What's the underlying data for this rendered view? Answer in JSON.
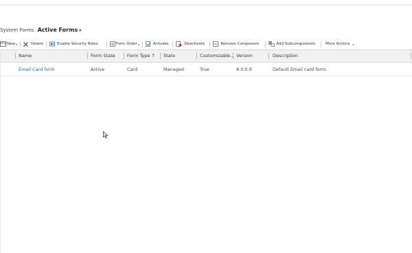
{
  "view": {
    "prefix": "System Forms",
    "name": "Active Forms"
  },
  "toolbar": {
    "new": "New",
    "delete": "Delete",
    "enable_security_roles": "Enable Security Roles",
    "form_order": "Form Order",
    "activate": "Activate",
    "deactivate": "Deactivate",
    "remove_component": "Remove Component",
    "add_subcomponents": "Add Subcomponents",
    "more_actions": "More Actions"
  },
  "columns": {
    "name": "Name",
    "form_state": "Form State",
    "form_type": "Form Type",
    "state": "State",
    "customizable": "Customizable...",
    "version": "Version",
    "description": "Description"
  },
  "rows": [
    {
      "name": "Email Card form",
      "form_state": "Active",
      "form_type": "Card",
      "state": "Managed",
      "customizable": "True",
      "version": "8.0.0.0",
      "description": "Default Email card form."
    }
  ]
}
